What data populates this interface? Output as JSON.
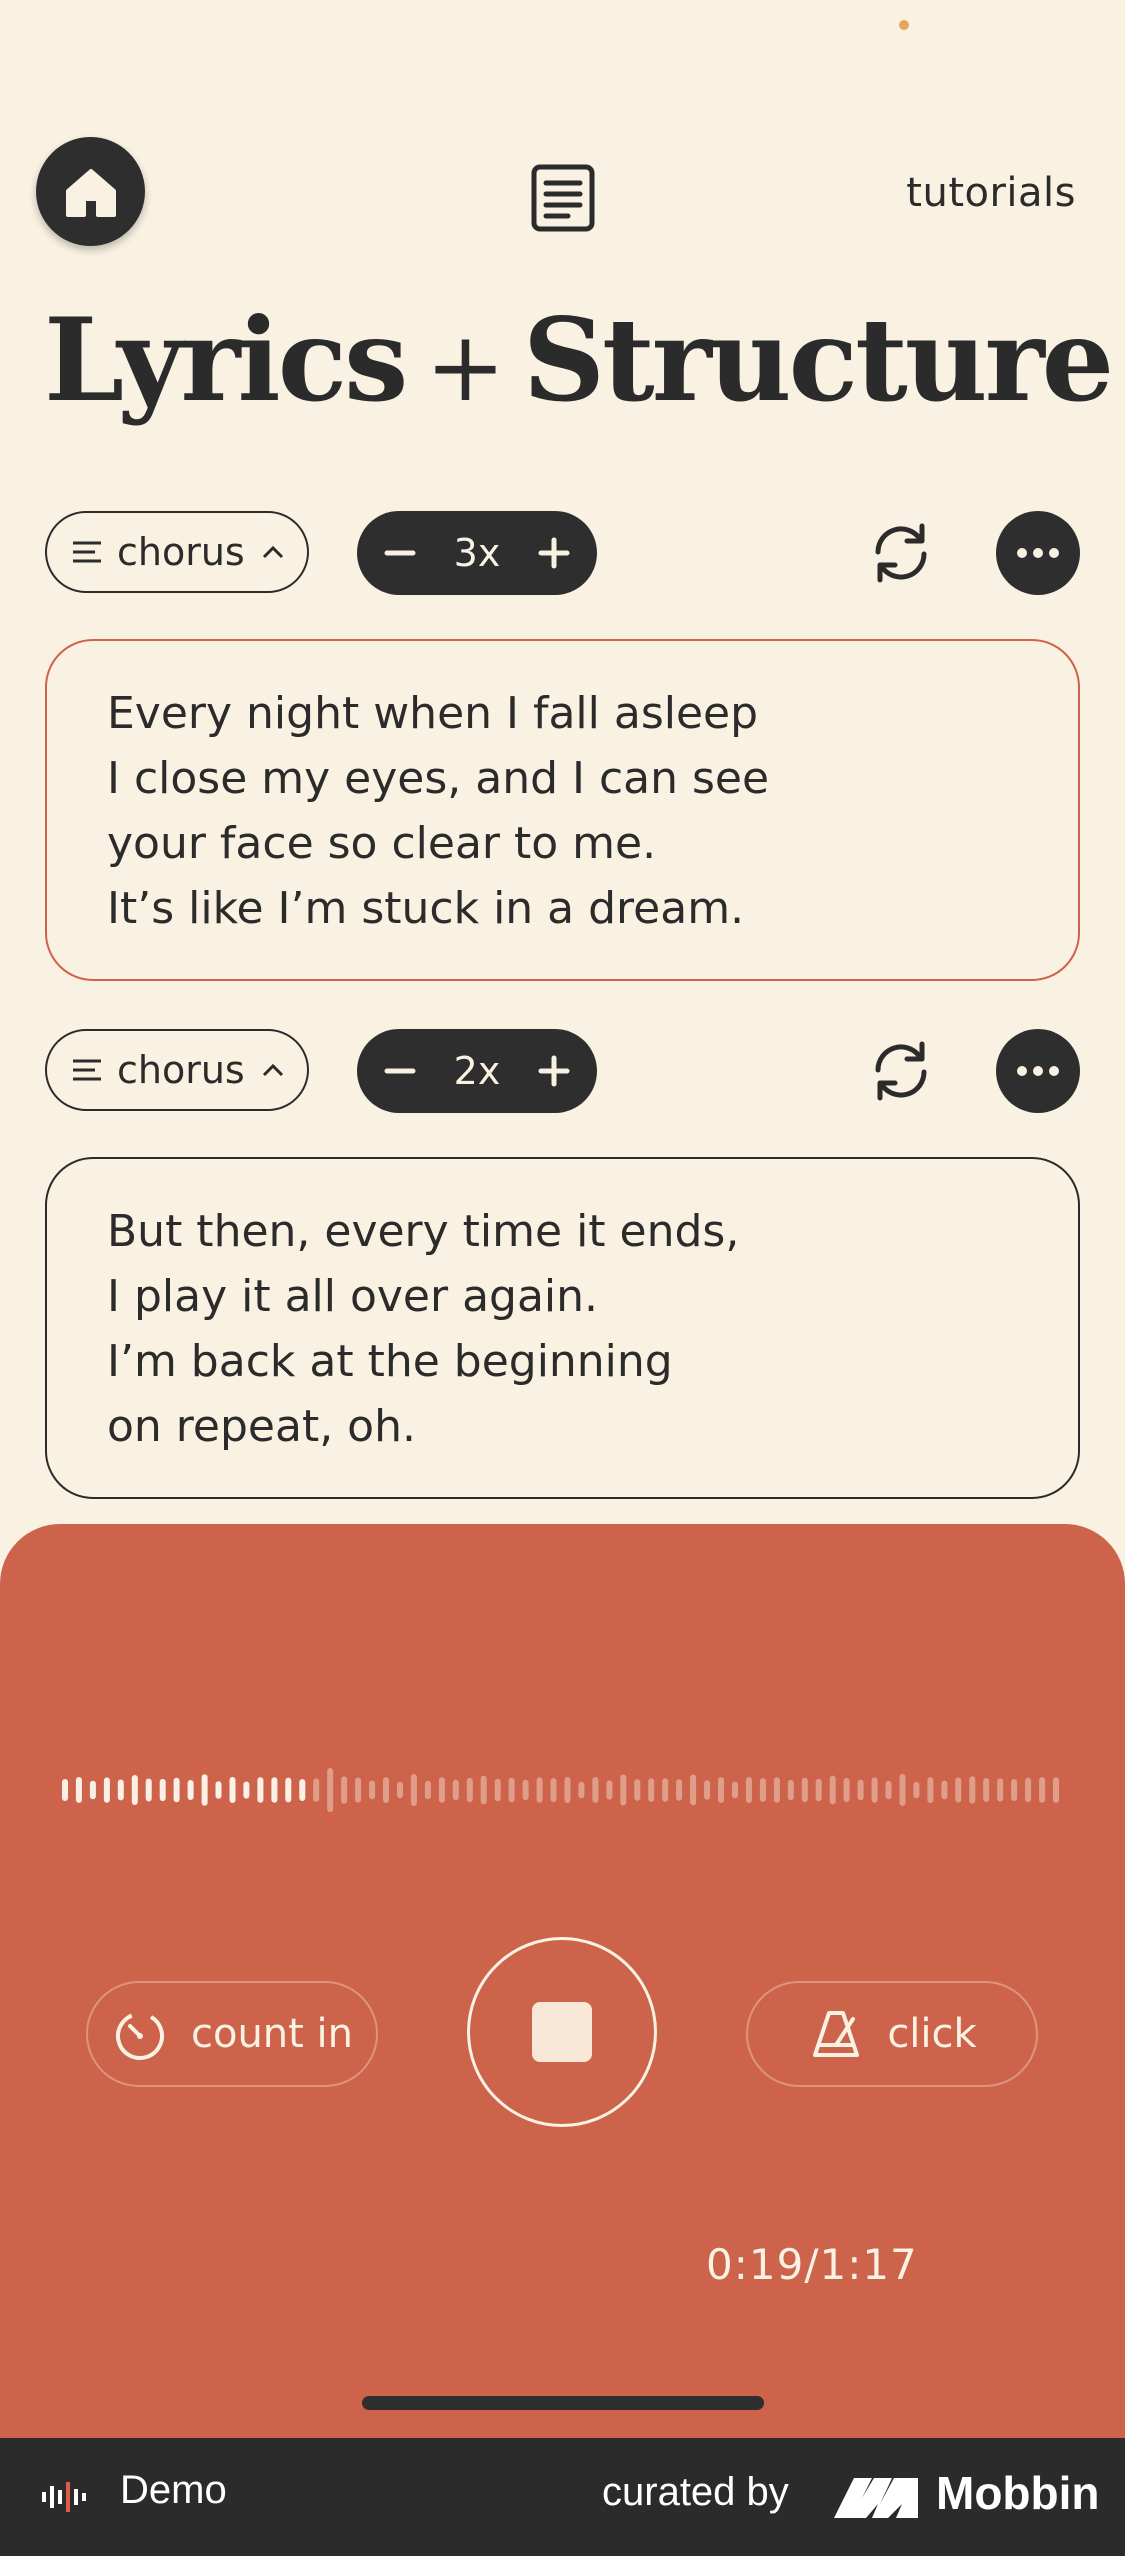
{
  "header": {
    "tutorials_label": "tutorials",
    "home_icon": "home-icon",
    "doc_icon": "document-icon"
  },
  "page": {
    "title_part1": "Lyrics",
    "title_plus": "+",
    "title_part2": "Structure"
  },
  "sections": [
    {
      "section_label": "chorus",
      "repeat_count": "3x",
      "active": true,
      "lines": [
        "Every night when I fall asleep",
        "I close my eyes, and I can see",
        "your face so clear to me.",
        "It’s like I’m stuck in a dream."
      ]
    },
    {
      "section_label": "chorus",
      "repeat_count": "2x",
      "active": false,
      "lines": [
        "But then, every time it ends,",
        "I play it all over again.",
        "I’m back at the beginning",
        "on repeat, oh."
      ]
    }
  ],
  "player": {
    "count_in_label": "count in",
    "click_label": "click",
    "time": "0:19/1:17",
    "progress": 0.25
  },
  "footer": {
    "demo_label": "Demo",
    "curated_label": "curated by",
    "brand": "Mobbin"
  },
  "colors": {
    "background": "#f9f2e3",
    "dark": "#2f2e2e",
    "accent": "#cd634b"
  }
}
